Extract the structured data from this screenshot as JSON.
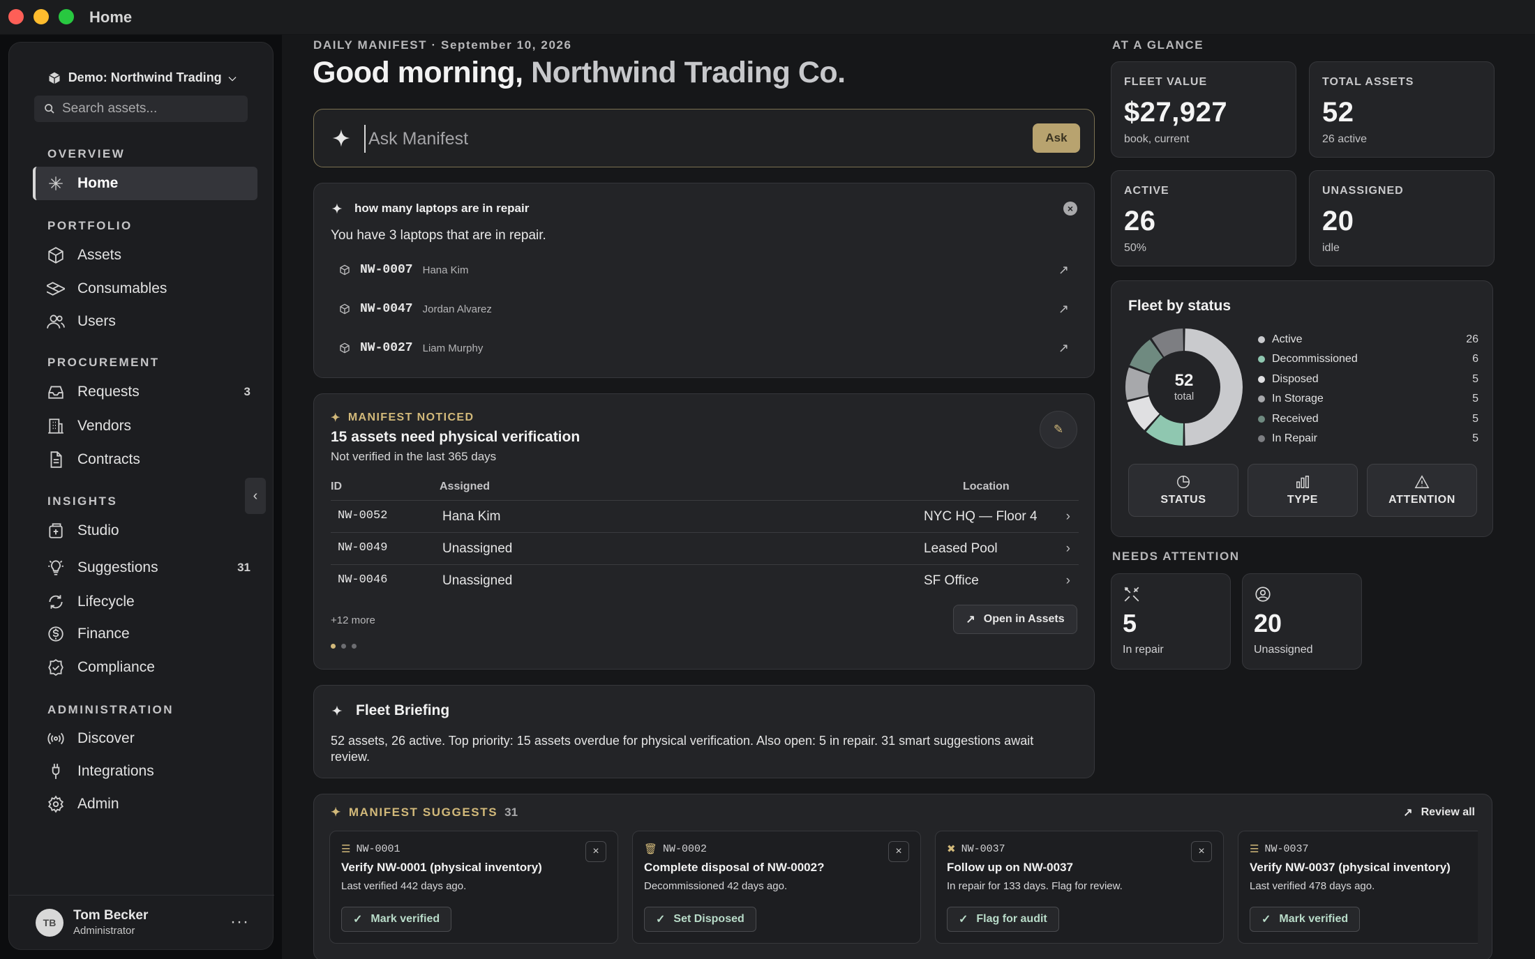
{
  "window": {
    "title": "Home"
  },
  "sidebar": {
    "workspace": "Demo: Northwind Trading",
    "search_placeholder": "Search assets...",
    "sections": {
      "overview": "OVERVIEW",
      "portfolio": "PORTFOLIO",
      "procurement": "PROCUREMENT",
      "insights": "INSIGHTS",
      "administration": "ADMINISTRATION"
    },
    "items": [
      {
        "label": "Home",
        "icon": "sparkle-icon"
      },
      {
        "label": "Assets",
        "icon": "cube-icon"
      },
      {
        "label": "Consumables",
        "icon": "boxes-icon"
      },
      {
        "label": "Users",
        "icon": "users-icon"
      },
      {
        "label": "Requests",
        "icon": "inbox-icon",
        "badge": "3"
      },
      {
        "label": "Vendors",
        "icon": "building-icon"
      },
      {
        "label": "Contracts",
        "icon": "document-icon"
      },
      {
        "label": "Studio",
        "icon": "studio-icon"
      },
      {
        "label": "Suggestions",
        "icon": "lightbulb-icon",
        "badge": "31"
      },
      {
        "label": "Lifecycle",
        "icon": "refresh-icon"
      },
      {
        "label": "Finance",
        "icon": "dollar-icon"
      },
      {
        "label": "Compliance",
        "icon": "badge-check-icon"
      },
      {
        "label": "Discover",
        "icon": "broadcast-icon"
      },
      {
        "label": "Integrations",
        "icon": "plug-icon"
      },
      {
        "label": "Admin",
        "icon": "gear-icon"
      }
    ],
    "user": {
      "initials": "TB",
      "name": "Tom Becker",
      "role": "Administrator"
    }
  },
  "header": {
    "kicker": "DAILY MANIFEST · September 10, 2026",
    "greeting": "Good morning,",
    "org": "Northwind Trading Co."
  },
  "ask": {
    "placeholder": "Ask Manifest",
    "button": "Ask"
  },
  "qa": {
    "question": "how many laptops are in repair",
    "answer": "You have 3 laptops that are in repair.",
    "results": [
      {
        "id": "NW-0007",
        "name": "Hana Kim"
      },
      {
        "id": "NW-0047",
        "name": "Jordan Alvarez"
      },
      {
        "id": "NW-0027",
        "name": "Liam Murphy"
      }
    ]
  },
  "noticed": {
    "tag": "MANIFEST NOTICED",
    "title": "15 assets need physical verification",
    "subtitle": "Not verified in the last 365 days",
    "columns": {
      "id": "ID",
      "assigned": "Assigned",
      "location": "Location"
    },
    "rows": [
      {
        "id": "NW-0052",
        "assigned": "Hana Kim",
        "location": "NYC HQ — Floor 4"
      },
      {
        "id": "NW-0049",
        "assigned": "Unassigned",
        "location": "Leased Pool"
      },
      {
        "id": "NW-0046",
        "assigned": "Unassigned",
        "location": "SF Office"
      }
    ],
    "more": "+12 more",
    "open_button": "Open in Assets"
  },
  "briefing": {
    "title": "Fleet Briefing",
    "body": "52 assets, 26 active. Top priority: 15 assets overdue for physical verification. Also open: 5 in repair. 31 smart suggestions await review."
  },
  "glance": {
    "heading": "AT A GLANCE",
    "stats": [
      {
        "label": "FLEET VALUE",
        "value": "$27,927",
        "sub": "book, current"
      },
      {
        "label": "TOTAL ASSETS",
        "value": "52",
        "sub": "26 active"
      },
      {
        "label": "ACTIVE",
        "value": "26",
        "sub": "50%"
      },
      {
        "label": "UNASSIGNED",
        "value": "20",
        "sub": "idle"
      }
    ]
  },
  "fleet": {
    "title": "Fleet by status",
    "total": "52",
    "total_label": "total",
    "tabs": [
      "STATUS",
      "TYPE",
      "ATTENTION"
    ]
  },
  "chart_data": {
    "type": "pie",
    "title": "Fleet by status",
    "categories": [
      "Active",
      "Decommissioned",
      "Disposed",
      "In Storage",
      "Received",
      "In Repair"
    ],
    "values": [
      26,
      6,
      5,
      5,
      5,
      5
    ],
    "colors": [
      "#c9cacd",
      "#8fc7b0",
      "#e0e0e2",
      "#a7a8ab",
      "#6f8a80",
      "#7d7e82"
    ],
    "legend_placement": "right"
  },
  "attention": {
    "heading": "NEEDS ATTENTION",
    "items": [
      {
        "value": "5",
        "label": "In repair",
        "icon": "wrench-icon"
      },
      {
        "value": "20",
        "label": "Unassigned",
        "icon": "user-circle-icon"
      }
    ]
  },
  "suggestions": {
    "heading": "MANIFEST SUGGESTS",
    "count": "31",
    "review_all": "Review all",
    "cards": [
      {
        "id": "NW-0001",
        "title": "Verify NW-0001 (physical inventory)",
        "desc": "Last verified 442 days ago.",
        "action": "Mark verified",
        "icon": "checklist-icon"
      },
      {
        "id": "NW-0002",
        "title": "Complete disposal of NW-0002?",
        "desc": "Decommissioned 42 days ago.",
        "action": "Set Disposed",
        "icon": "trash-icon"
      },
      {
        "id": "NW-0037",
        "title": "Follow up on NW-0037",
        "desc": "In repair for 133 days. Flag for review.",
        "action": "Flag for audit",
        "icon": "wrench-icon"
      },
      {
        "id": "NW-0037",
        "title": "Verify NW-0037 (physical inventory)",
        "desc": "Last verified 478 days ago.",
        "action": "Mark verified",
        "icon": "checklist-icon"
      }
    ]
  }
}
